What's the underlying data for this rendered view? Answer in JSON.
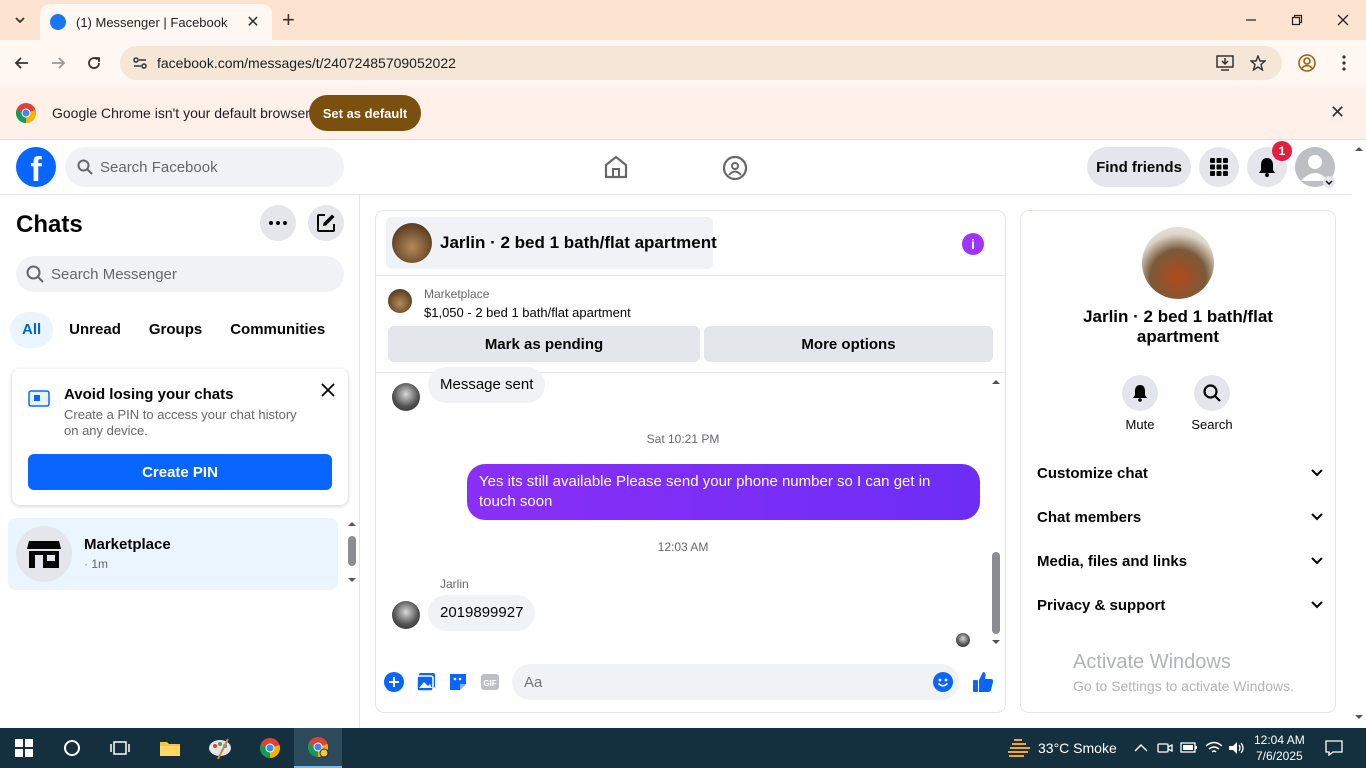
{
  "browser": {
    "tab_title": "(1) Messenger | Facebook",
    "url": "facebook.com/messages/t/24072485709052022",
    "infobar_message": "Google Chrome isn't your default browser",
    "set_default_label": "Set as default"
  },
  "fb": {
    "search_placeholder": "Search Facebook",
    "find_friends_label": "Find friends",
    "notification_count": "1"
  },
  "chats": {
    "title": "Chats",
    "search_placeholder": "Search Messenger",
    "filters": [
      "All",
      "Unread",
      "Groups",
      "Communities"
    ],
    "active_filter": "All",
    "pin_card": {
      "title": "Avoid losing your chats",
      "description": "Create a PIN to access your chat history on any device.",
      "button": "Create PIN"
    },
    "list": [
      {
        "name": "Marketplace",
        "subtitle": "· 1m"
      }
    ]
  },
  "conversation": {
    "title": "Jarlin · 2 bed 1 bath/flat apartment",
    "marketplace_label": "Marketplace",
    "listing": "$1,050 - 2 bed 1 bath/flat apartment",
    "mark_pending_label": "Mark as pending",
    "more_options_label": "More options",
    "messages": [
      {
        "type": "in",
        "text": "Message sent"
      },
      {
        "type": "timestamp",
        "text": "Sat 10:21 PM"
      },
      {
        "type": "out",
        "text": "Yes its still available Please send your phone number so I can get in touch soon"
      },
      {
        "type": "timestamp",
        "text": "12:03 AM"
      },
      {
        "type": "in",
        "sender": "Jarlin",
        "text": "2019899927"
      }
    ],
    "composer_placeholder": "Aa"
  },
  "info_panel": {
    "name": "Jarlin · 2 bed 1 bath/flat apartment",
    "actions": [
      {
        "label": "Mute",
        "icon": "bell-icon"
      },
      {
        "label": "Search",
        "icon": "search-icon"
      }
    ],
    "sections": [
      "Customize chat",
      "Chat members",
      "Media, files and links",
      "Privacy & support"
    ]
  },
  "watermark": {
    "line1": "Activate Windows",
    "line2": "Go to Settings to activate Windows."
  },
  "taskbar": {
    "weather": "33°C  Smoke",
    "time": "12:04 AM",
    "date": "7/6/2025"
  }
}
